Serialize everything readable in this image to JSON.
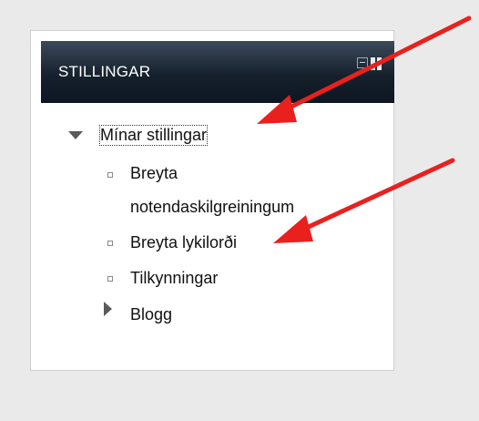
{
  "block": {
    "title": "STILLINGAR"
  },
  "tree": {
    "parent_label": "Mínar stillingar",
    "items": [
      {
        "label_line1": "Breyta",
        "label_line2": "notendaskilgreiningum"
      },
      {
        "label": "Breyta lykilorði"
      },
      {
        "label": "Tilkynningar"
      }
    ],
    "collapsed_label": "Blogg"
  },
  "colors": {
    "header_bg": "#16212d",
    "arrow": "#e8211f",
    "page_bg": "#eaeaea"
  },
  "icons": {
    "header_left": "minimize-icon",
    "header_right": "dock-icon",
    "expanded": "triangle-down-icon",
    "collapsed": "triangle-right-icon",
    "item": "square-bullet-icon",
    "annotation": "red-arrow-icon"
  }
}
